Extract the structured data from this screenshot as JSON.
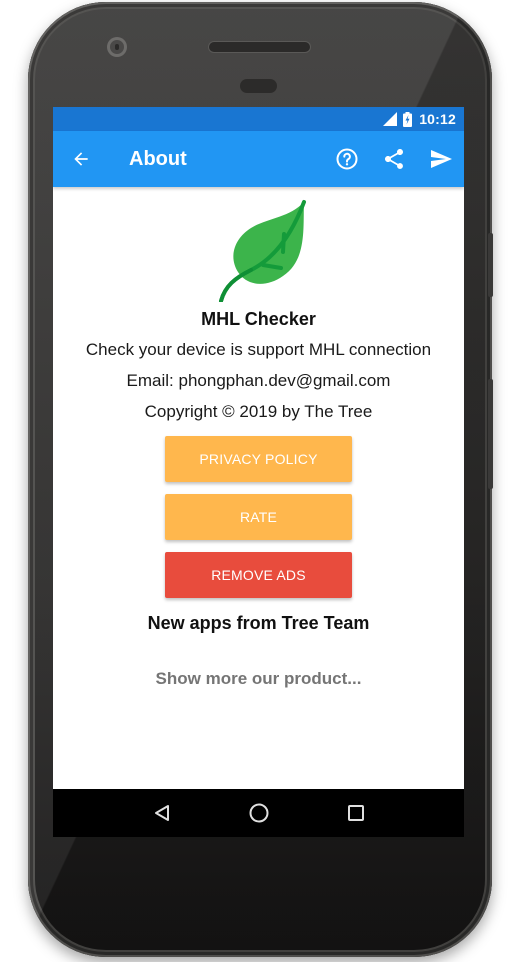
{
  "status_bar": {
    "time": "10:12",
    "icons": [
      "signal-icon",
      "battery-charging-icon"
    ]
  },
  "app_bar": {
    "title": "About",
    "back_icon": "arrow-back-icon",
    "actions": [
      {
        "name": "help",
        "icon": "help-circle-icon"
      },
      {
        "name": "share",
        "icon": "share-icon"
      },
      {
        "name": "send",
        "icon": "send-icon"
      }
    ],
    "color": "#2196f3",
    "status_color": "#1976d2"
  },
  "about": {
    "logo_icon": "leaf-icon",
    "logo_color": "#3cb44b",
    "app_name": "MHL Checker",
    "description": "Check your device is support MHL connection",
    "email": "Email: phongphan.dev@gmail.com",
    "copyright": "Copyright © 2019 by The Tree"
  },
  "buttons": {
    "privacy_policy": {
      "label": "PRIVACY POLICY",
      "color": "#ffb74d"
    },
    "rate": {
      "label": "RATE",
      "color": "#ffb74d"
    },
    "remove_ads": {
      "label": "REMOVE ADS",
      "color": "#e84c3d"
    }
  },
  "more_apps": {
    "title": "New apps from Tree Team",
    "link": "Show more our product..."
  },
  "nav_bar": {
    "icons": [
      "back-triangle-icon",
      "home-circle-icon",
      "recents-square-icon"
    ]
  }
}
